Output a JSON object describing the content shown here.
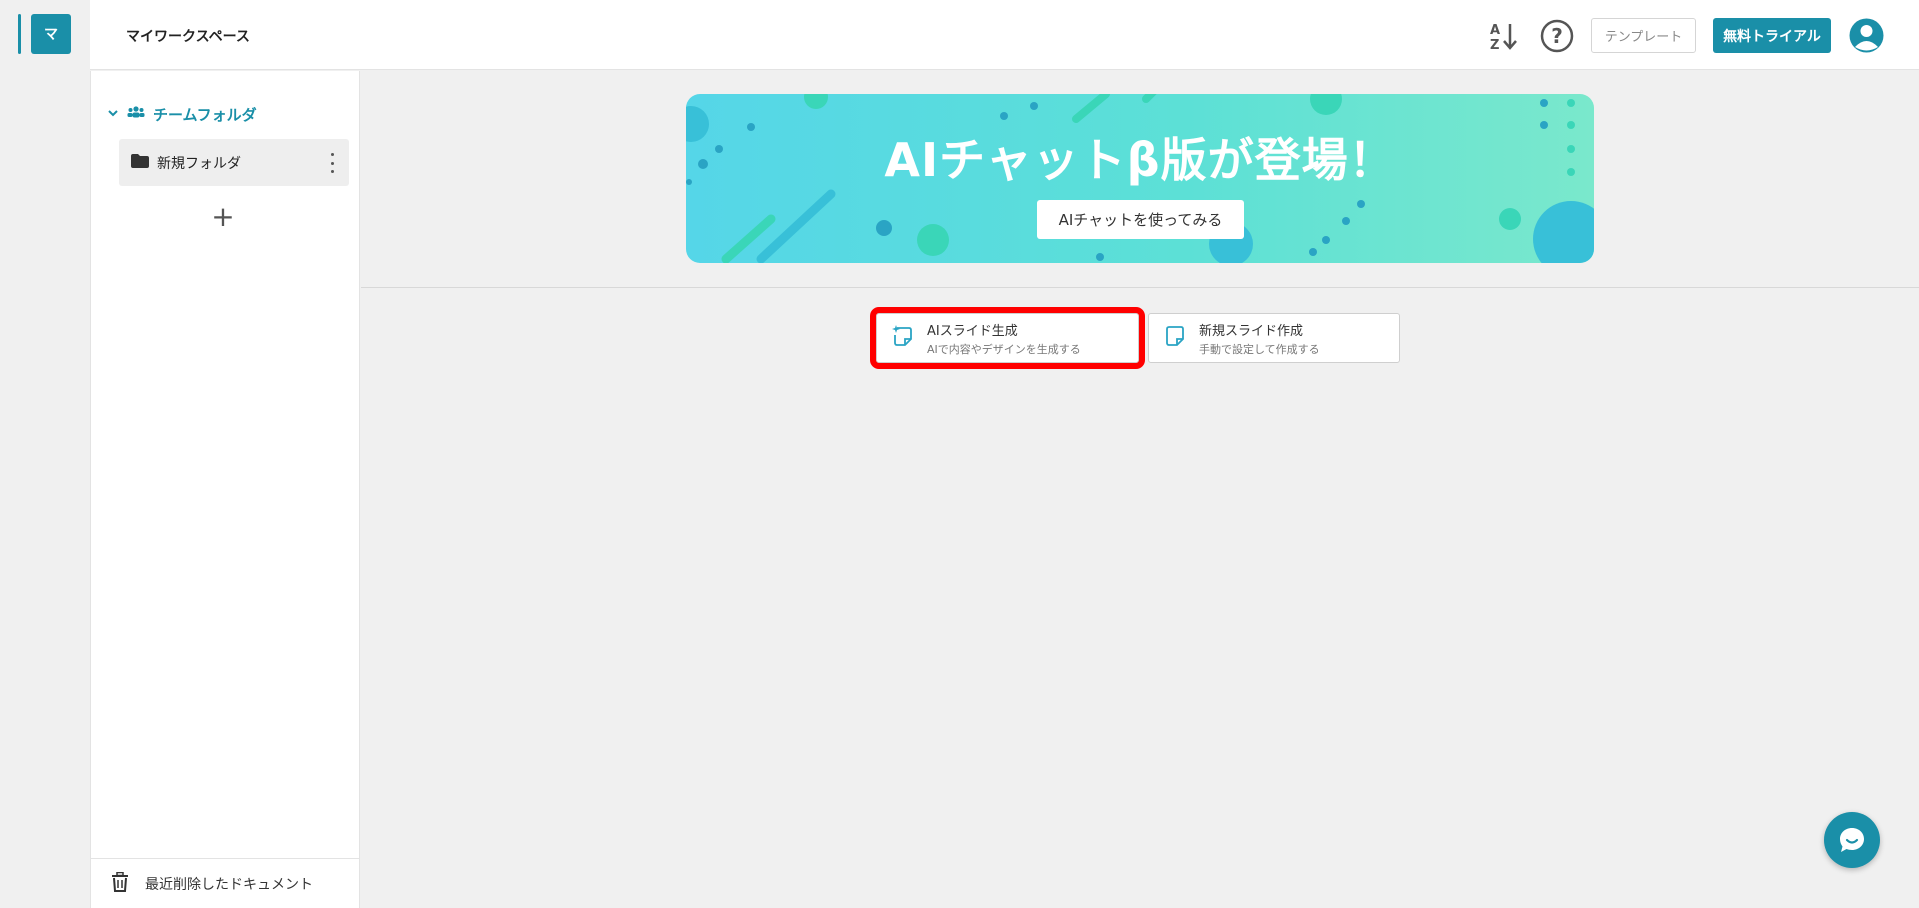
{
  "workspace": {
    "avatar_letter": "マ",
    "title": "マイワークスペース"
  },
  "header": {
    "sort_icon": "sort-az-icon",
    "help_icon": "help-icon",
    "template_label": "テンプレート",
    "trial_label": "無料トライアル",
    "user_icon": "user-avatar-icon"
  },
  "sidebar": {
    "team_folder_label": "チームフォルダ",
    "folders": [
      {
        "label": "新規フォルダ"
      }
    ],
    "add_icon": "+",
    "trash_label": "最近削除したドキュメント"
  },
  "banner": {
    "title": "AIチャットβ版が登場！",
    "button_label": "AIチャットを使ってみる"
  },
  "create_options": [
    {
      "title": "AIスライド生成",
      "subtitle": "AIで内容やデザインを生成する"
    },
    {
      "title": "新規スライド作成",
      "subtitle": "手動で設定して作成する"
    }
  ],
  "colors": {
    "accent": "#1a8fa8",
    "highlight": "#ff0000"
  }
}
